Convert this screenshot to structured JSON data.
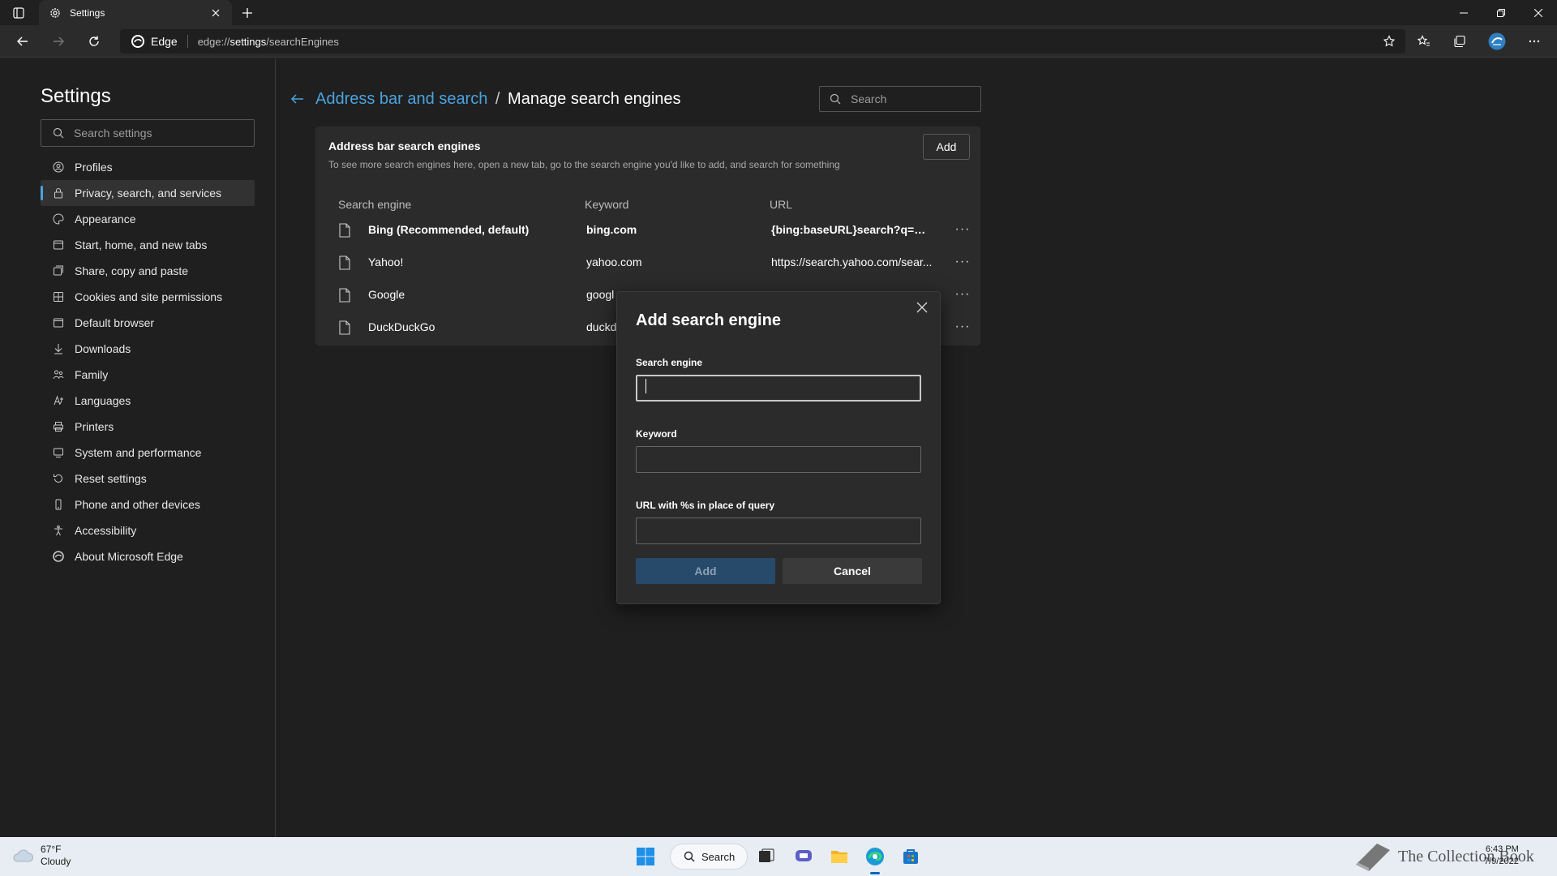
{
  "browser": {
    "tab_title": "Settings",
    "address_label": "Edge",
    "url_prefix": "edge://",
    "url_emphasis": "settings",
    "url_suffix": "/searchEngines"
  },
  "sidebar": {
    "title": "Settings",
    "search_placeholder": "Search settings",
    "items": [
      {
        "label": "Profiles",
        "icon": "profile-icon"
      },
      {
        "label": "Privacy, search, and services",
        "icon": "lock-icon",
        "active": true
      },
      {
        "label": "Appearance",
        "icon": "appearance-icon"
      },
      {
        "label": "Start, home, and new tabs",
        "icon": "home-tabs-icon"
      },
      {
        "label": "Share, copy and paste",
        "icon": "share-icon"
      },
      {
        "label": "Cookies and site permissions",
        "icon": "cookies-icon"
      },
      {
        "label": "Default browser",
        "icon": "browser-icon"
      },
      {
        "label": "Downloads",
        "icon": "download-icon"
      },
      {
        "label": "Family",
        "icon": "family-icon"
      },
      {
        "label": "Languages",
        "icon": "languages-icon"
      },
      {
        "label": "Printers",
        "icon": "printer-icon"
      },
      {
        "label": "System and performance",
        "icon": "system-icon"
      },
      {
        "label": "Reset settings",
        "icon": "reset-icon"
      },
      {
        "label": "Phone and other devices",
        "icon": "phone-icon"
      },
      {
        "label": "Accessibility",
        "icon": "accessibility-icon"
      },
      {
        "label": "About Microsoft Edge",
        "icon": "edge-icon"
      }
    ]
  },
  "main": {
    "breadcrumb_parent": "Address bar and search",
    "breadcrumb_sep": "/",
    "breadcrumb_current": "Manage search engines",
    "search_placeholder": "Search",
    "card": {
      "title": "Address bar search engines",
      "subtitle": "To see more search engines here, open a new tab, go to the search engine you'd like to add, and search for something",
      "add_label": "Add",
      "columns": [
        "Search engine",
        "Keyword",
        "URL"
      ],
      "rows": [
        {
          "name": "Bing (Recommended, default)",
          "keyword": "bing.com",
          "url": "{bing:baseURL}search?q=%s&...",
          "bold": true
        },
        {
          "name": "Yahoo!",
          "keyword": "yahoo.com",
          "url": "https://search.yahoo.com/sear..."
        },
        {
          "name": "Google",
          "keyword": "googl",
          "url": ""
        },
        {
          "name": "DuckDuckGo",
          "keyword": "duckd",
          "url": ""
        }
      ],
      "more_label": "···"
    }
  },
  "dialog": {
    "title": "Add search engine",
    "field1_label": "Search engine",
    "field1_value": "",
    "field2_label": "Keyword",
    "field2_value": "",
    "field3_label": "URL with %s in place of query",
    "field3_value": "",
    "add_label": "Add",
    "cancel_label": "Cancel"
  },
  "taskbar": {
    "weather_temp": "67°F",
    "weather_desc": "Cloudy",
    "search_label": "Search",
    "time": "6:43 PM",
    "date": "7/9/2022",
    "watermark": "The Collection Book"
  },
  "colors": {
    "accent": "#4aa3df",
    "primary_disabled": "#274a6b",
    "background": "#1f1f1f",
    "card": "#2b2b2b"
  }
}
